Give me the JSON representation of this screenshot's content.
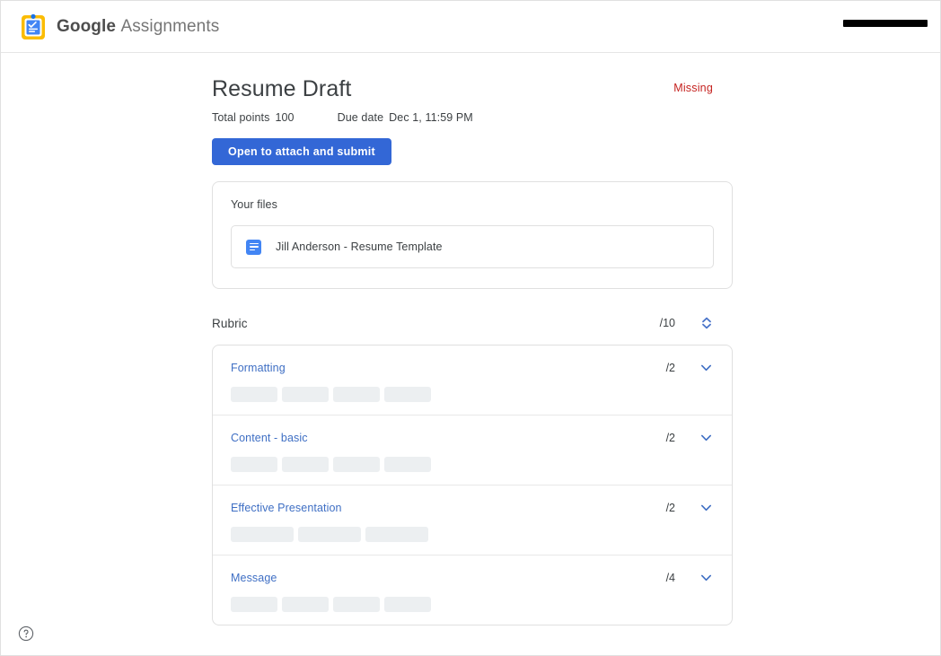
{
  "header": {
    "logo_icon": "clipboard-check-icon",
    "brand_primary": "Google",
    "brand_secondary": "Assignments",
    "account_redacted": true,
    "colors": {
      "brand_yellow": "#fbbc04",
      "brand_blue": "#4285f4"
    }
  },
  "assignment": {
    "title": "Resume Draft",
    "status": "Missing",
    "status_color": "#c5221f",
    "total_points_label": "Total points",
    "total_points_value": "100",
    "due_date_label": "Due date",
    "due_date_value": "Dec 1, 11:59 PM",
    "submit_button": "Open to attach and submit",
    "submit_button_color": "#3367d6"
  },
  "files": {
    "section_title": "Your files",
    "items": [
      {
        "name": "Jill Anderson - Resume Template",
        "icon": "google-docs-icon"
      }
    ]
  },
  "rubric": {
    "label": "Rubric",
    "total": "/10",
    "sort_icon": "chevron-up-down-icon",
    "criteria": [
      {
        "name": "Formatting",
        "points": "/2",
        "chevron": "chevron-down-icon",
        "chips": [
          52,
          52,
          52,
          52
        ]
      },
      {
        "name": "Content - basic",
        "points": "/2",
        "chevron": "chevron-down-icon",
        "chips": [
          52,
          52,
          52,
          52
        ]
      },
      {
        "name": "Effective Presentation",
        "points": "/2",
        "chevron": "chevron-down-icon",
        "chips": [
          70,
          70,
          70
        ]
      },
      {
        "name": "Message",
        "points": "/4",
        "chevron": "chevron-down-icon",
        "chips": [
          52,
          52,
          52,
          52
        ]
      }
    ]
  },
  "footer": {
    "help_icon": "help-circle-icon"
  }
}
